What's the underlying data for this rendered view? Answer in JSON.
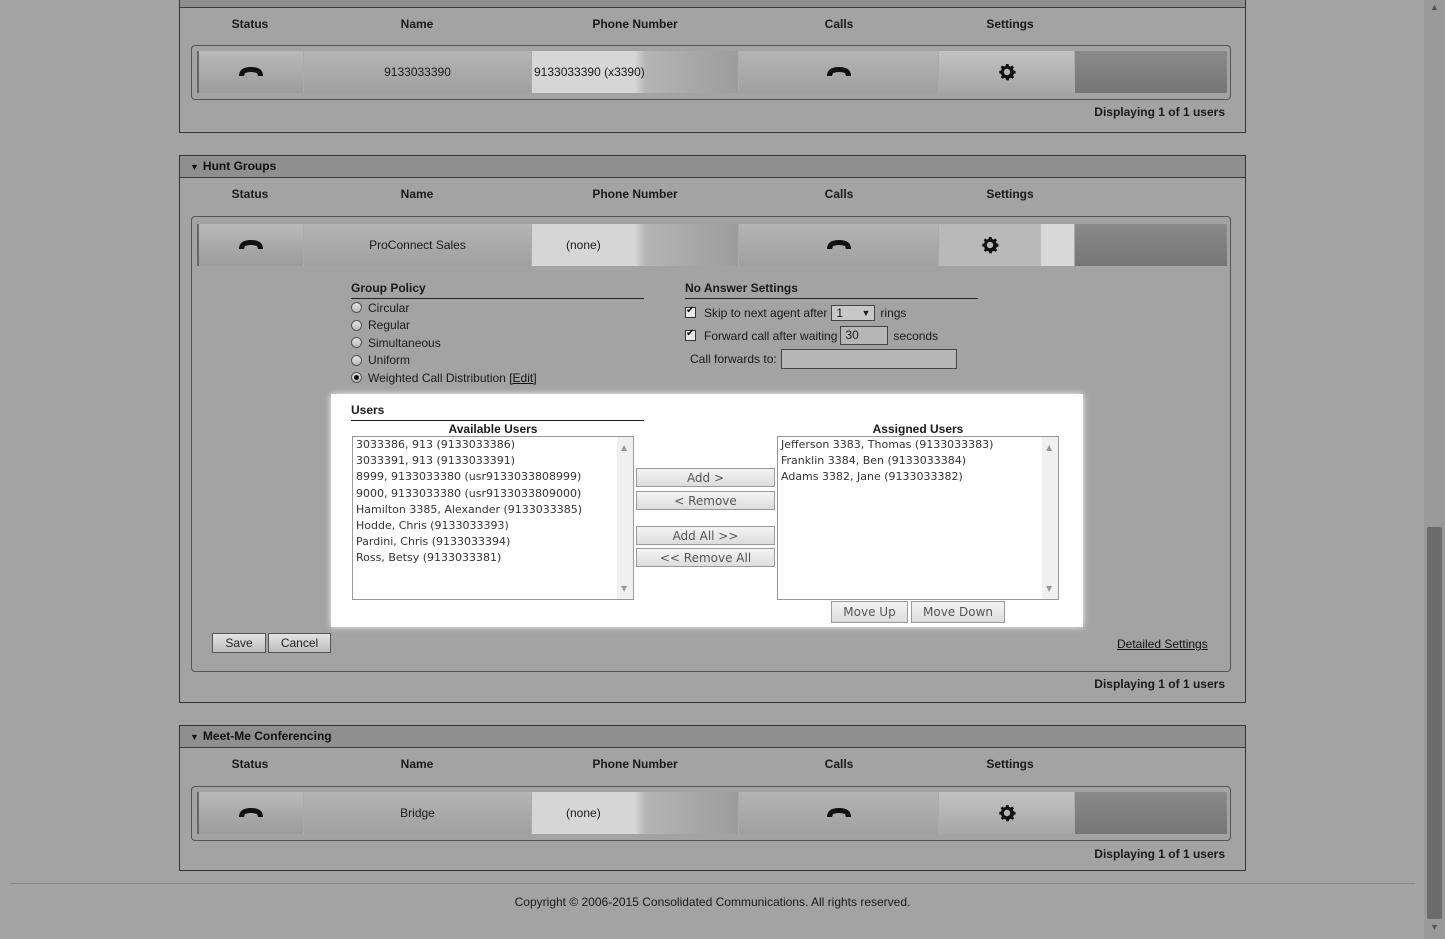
{
  "columns": {
    "status": "Status",
    "name": "Name",
    "phone": "Phone Number",
    "calls": "Calls",
    "settings": "Settings"
  },
  "top_section": {
    "row": {
      "name": "9133033390",
      "phone": "9133033390 (x3390)"
    },
    "display": "Displaying 1 of 1 users"
  },
  "hunt_groups": {
    "title": "Hunt Groups",
    "row": {
      "name": "ProConnect Sales",
      "phone": "(none)"
    },
    "group_policy": {
      "heading": "Group Policy",
      "options": [
        "Circular",
        "Regular",
        "Simultaneous",
        "Uniform",
        "Weighted Call Distribution"
      ],
      "selected": "Weighted Call Distribution",
      "edit_link": "[Edit]"
    },
    "no_answer": {
      "heading": "No Answer Settings",
      "skip_label": "Skip to next agent after",
      "skip_value": "1",
      "skip_suffix": "rings",
      "forward_label": "Forward call after waiting",
      "forward_value": "30",
      "forward_suffix": "seconds",
      "forwards_to_label": "Call forwards to:",
      "forwards_to_value": ""
    },
    "users": {
      "heading": "Users",
      "available_heading": "Available Users",
      "assigned_heading": "Assigned Users",
      "available": [
        "3033386, 913 (9133033386)",
        "3033391, 913 (9133033391)",
        "8999, 9133033380 (usr9133033808999)",
        "9000, 9133033380 (usr9133033809000)",
        "Hamilton 3385, Alexander (9133033385)",
        "Hodde, Chris (9133033393)",
        "Pardini, Chris (9133033394)",
        "Ross, Betsy (9133033381)"
      ],
      "assigned": [
        "Jefferson 3383, Thomas (9133033383)",
        "Franklin 3384, Ben (9133033384)",
        "Adams 3382, Jane (9133033382)"
      ],
      "add": "Add >",
      "remove": "< Remove",
      "add_all": "Add All >>",
      "remove_all": "<< Remove All",
      "move_up": "Move Up",
      "move_down": "Move Down"
    },
    "save": "Save",
    "cancel": "Cancel",
    "detailed_settings": "Detailed Settings",
    "display": "Displaying 1 of 1 users"
  },
  "meet_me": {
    "title": "Meet-Me Conferencing",
    "row": {
      "name": "Bridge",
      "phone": "(none)"
    },
    "display": "Displaying 1 of 1 users"
  },
  "footer": {
    "copyright": "Copyright © 2006-2015 Consolidated Communications. All rights reserved."
  },
  "icons": {
    "status": "phone-icon",
    "calls": "phone-icon",
    "settings": "gear-icon"
  }
}
